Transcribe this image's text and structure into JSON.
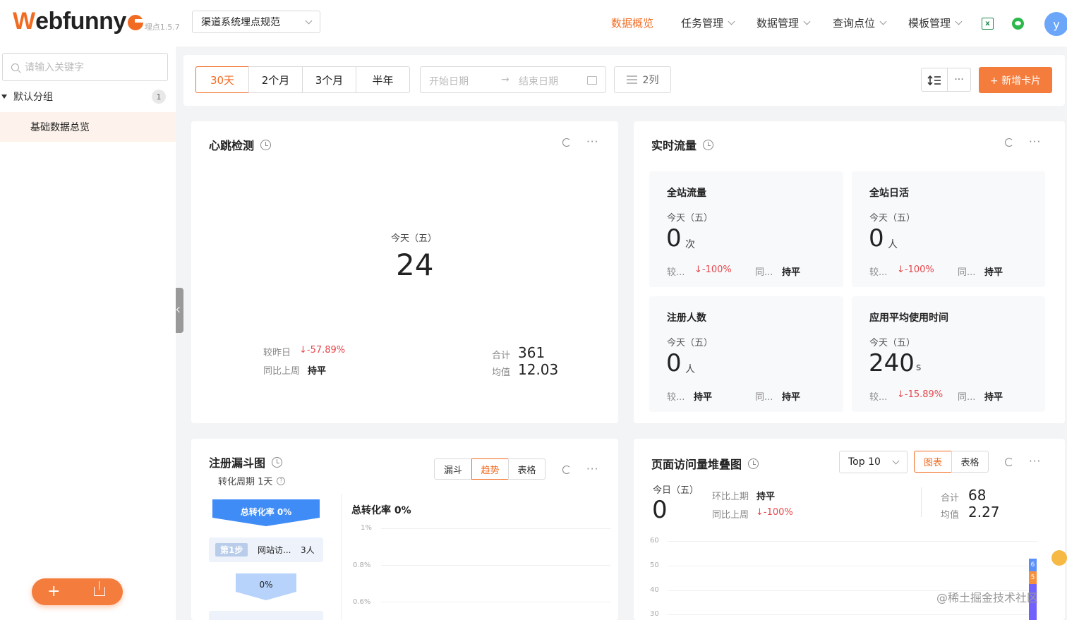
{
  "header": {
    "logo_w": "W",
    "logo_rest": "ebfunny",
    "logo_version": "埋点1.5.7",
    "project_select": "渠道系统埋点规范",
    "nav": [
      {
        "label": "数据概览",
        "active": true
      },
      {
        "label": "任务管理"
      },
      {
        "label": "数据管理"
      },
      {
        "label": "查询点位"
      },
      {
        "label": "模板管理"
      }
    ],
    "excel_icon_label": "x",
    "avatar_letter": "y"
  },
  "sidebar": {
    "search_placeholder": "请输入关键字",
    "group_label": "默认分组",
    "group_count": "1",
    "item_label": "基础数据总览"
  },
  "toolbar": {
    "ranges": [
      "30天",
      "2个月",
      "3个月",
      "半年"
    ],
    "active_range": "30天",
    "start_placeholder": "开始日期",
    "arrow": "→",
    "end_placeholder": "结束日期",
    "columns_label": "2列",
    "more_label": "···",
    "add_card_label": "+ 新增卡片"
  },
  "heartbeat": {
    "title": "心跳检测",
    "today_label": "今天（五）",
    "value": "24",
    "vs_yesterday_label": "较昨日",
    "vs_yesterday_value": "↓-57.89%",
    "vs_lastweek_label": "同比上周",
    "vs_lastweek_value": "持平",
    "total_label": "合计",
    "total_value": "361",
    "avg_label": "均值",
    "avg_value": "12.03"
  },
  "realtime": {
    "title": "实时流量",
    "cards": [
      {
        "title": "全站流量",
        "today": "今天（五）",
        "value": "0",
        "unit": "次",
        "cmp1_label": "较...",
        "cmp1_value": "↓-100%",
        "cmp2_label": "同...",
        "cmp2_value": "持平"
      },
      {
        "title": "全站日活",
        "today": "今天（五）",
        "value": "0",
        "unit": "人",
        "cmp1_label": "较...",
        "cmp1_value": "↓-100%",
        "cmp2_label": "同...",
        "cmp2_value": "持平"
      },
      {
        "title": "注册人数",
        "today": "今天（五）",
        "value": "0",
        "unit": "人",
        "cmp1_label": "较...",
        "cmp1_value": "持平",
        "cmp2_label": "同...",
        "cmp2_value": "持平"
      },
      {
        "title": "应用平均使用时间",
        "today": "今天（五）",
        "value": "240",
        "unit": "s",
        "cmp1_label": "较...",
        "cmp1_value": "↓-15.89%",
        "cmp2_label": "同...",
        "cmp2_value": "持平"
      }
    ]
  },
  "funnel": {
    "title": "注册漏斗图",
    "period_label": "转化周期 1天",
    "tabs": [
      "漏斗",
      "趋势",
      "表格"
    ],
    "active_tab": "趋势",
    "top_bar_label": "总转化率 0%",
    "step_badge": "第1步",
    "step_name": "网站访...",
    "step_count": "3人",
    "step_rate": "0%",
    "chart_title": "总转化率 0%",
    "y_ticks": [
      "1%",
      "0.8%",
      "0.6%"
    ]
  },
  "stacked": {
    "title": "页面访问量堆叠图",
    "topn_select": "Top 10",
    "tabs": [
      "图表",
      "表格"
    ],
    "active_tab": "图表",
    "today_label": "今日（五）",
    "value": "0",
    "cmp1_label": "环比上期",
    "cmp1_value": "持平",
    "cmp2_label": "同比上周",
    "cmp2_value": "↓-100%",
    "total_label": "合计",
    "total_value": "68",
    "avg_label": "均值",
    "avg_value": "2.27",
    "y_ticks": [
      "60",
      "50",
      "40",
      "30"
    ],
    "bar_labels": [
      "6",
      "5"
    ],
    "colors": {
      "blue": "#5b8ff9",
      "orange": "#f6903d",
      "purple": "#7262fd"
    }
  },
  "watermark": "@稀土掘金技术社区"
}
